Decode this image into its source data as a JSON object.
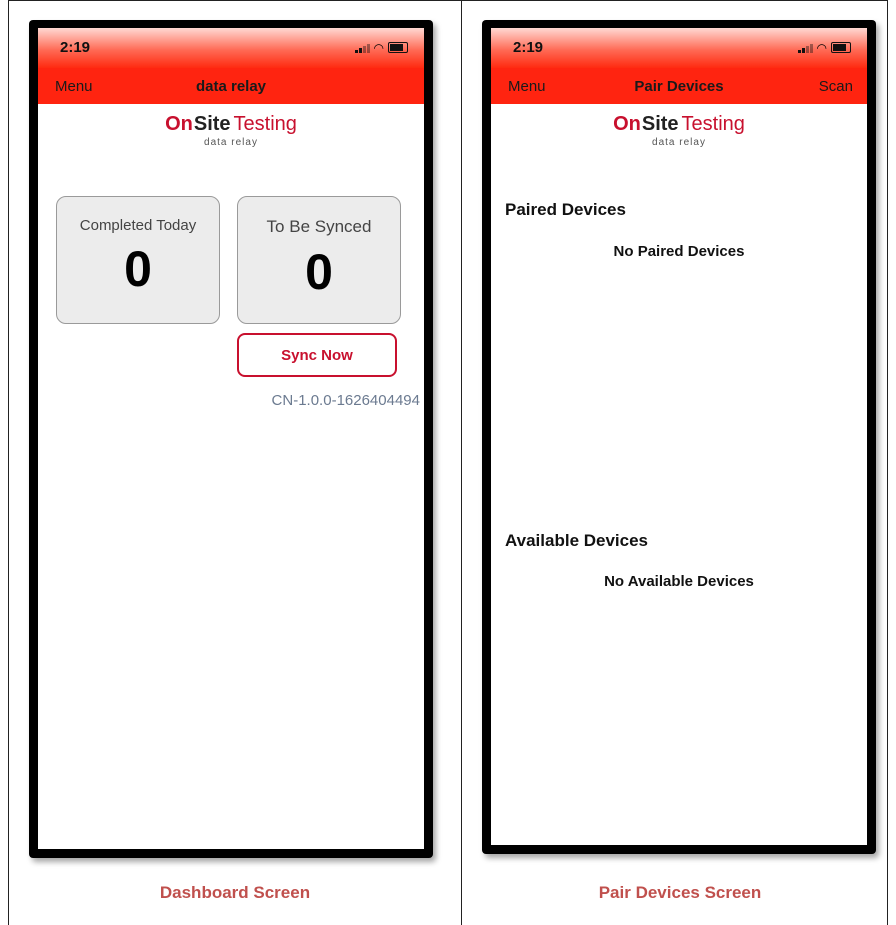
{
  "dashboard": {
    "status_time": "2:19",
    "nav": {
      "menu": "Menu",
      "title": "data relay"
    },
    "logo": {
      "on": "On",
      "site": "Site",
      "testing": "Testing",
      "sub": "data relay"
    },
    "tiles": [
      {
        "label": "Completed Today",
        "count": "0"
      },
      {
        "label": "To Be Synced",
        "count": "0"
      }
    ],
    "sync_button": "Sync Now",
    "version": "CN-1.0.0-1626404494"
  },
  "pair_devices": {
    "status_time": "2:19",
    "nav": {
      "menu": "Menu",
      "title": "Pair Devices",
      "scan": "Scan"
    },
    "logo": {
      "on": "On",
      "site": "Site",
      "testing": "Testing",
      "sub": "data relay"
    },
    "paired": {
      "title": "Paired Devices",
      "empty": "No Paired Devices"
    },
    "available": {
      "title": "Available Devices",
      "empty": "No Available Devices"
    }
  },
  "captions": {
    "left": "Dashboard Screen",
    "right": "Pair Devices Screen"
  },
  "colors": {
    "brand_red": "#c8102e",
    "nav_red": "#ff2410",
    "caption": "#c0504d"
  }
}
